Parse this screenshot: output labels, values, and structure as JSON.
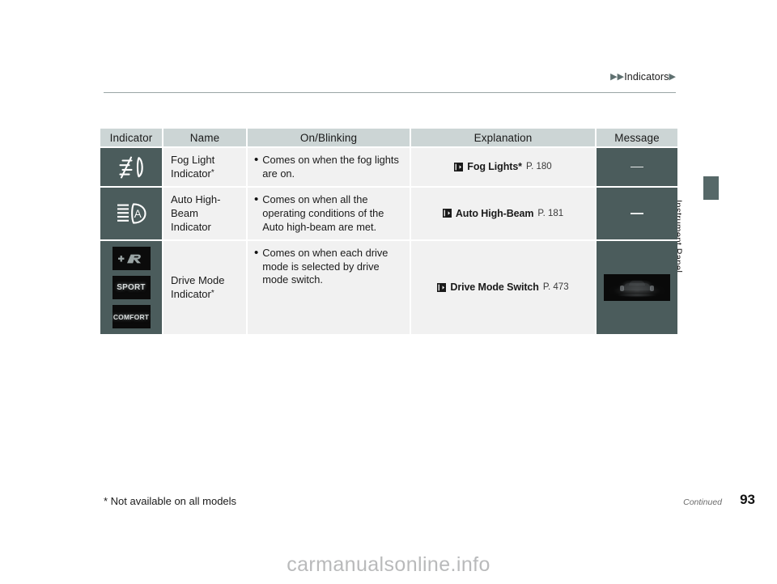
{
  "header": {
    "breadcrumb_arrow": "▶",
    "breadcrumb": "Indicators"
  },
  "side_tab": {
    "label": "Instrument Panel"
  },
  "table": {
    "columns": [
      "Indicator",
      "Name",
      "On/Blinking",
      "Explanation",
      "Message"
    ],
    "rows": [
      {
        "indicator_icon": "fog-light-icon",
        "name": "Fog Light",
        "name_line2": "Indicator",
        "name_star": "*",
        "bullet": "Comes on when the fog lights are on.",
        "ref_title": "Fog Lights*",
        "ref_page": "P. 180",
        "message": "—"
      },
      {
        "indicator_icon": "auto-high-beam-icon",
        "name": "Auto High-Beam",
        "name_line2": "Indicator",
        "name_star": "",
        "bullet": "Comes on when all the operating conditions of the Auto high-beam are met.",
        "ref_title": "Auto High-Beam",
        "ref_page": "P. 181",
        "message": "—"
      },
      {
        "indicator_icon": "drive-mode-badges",
        "name": "Drive Mode",
        "name_line2": "Indicator",
        "name_star": "*",
        "bullet": "Comes on when each drive mode is selected by drive mode switch.",
        "ref_title": "Drive Mode Switch",
        "ref_page": "P. 473",
        "message": ""
      }
    ]
  },
  "drive_modes": [
    {
      "id": "plus-r",
      "label": "+R"
    },
    {
      "id": "sport",
      "label": "SPORT"
    },
    {
      "id": "comfort",
      "label": "COMFORT"
    }
  ],
  "footer": {
    "footnote": "* Not available on all models",
    "continued": "Continued",
    "page_number": "93"
  },
  "watermark": "carmanualsonline.info",
  "colors": {
    "header_cell": "#ccd5d5",
    "dark_cell": "#4b5c5c",
    "body_cell": "#f1f1f1",
    "side_tab": "#566868"
  }
}
